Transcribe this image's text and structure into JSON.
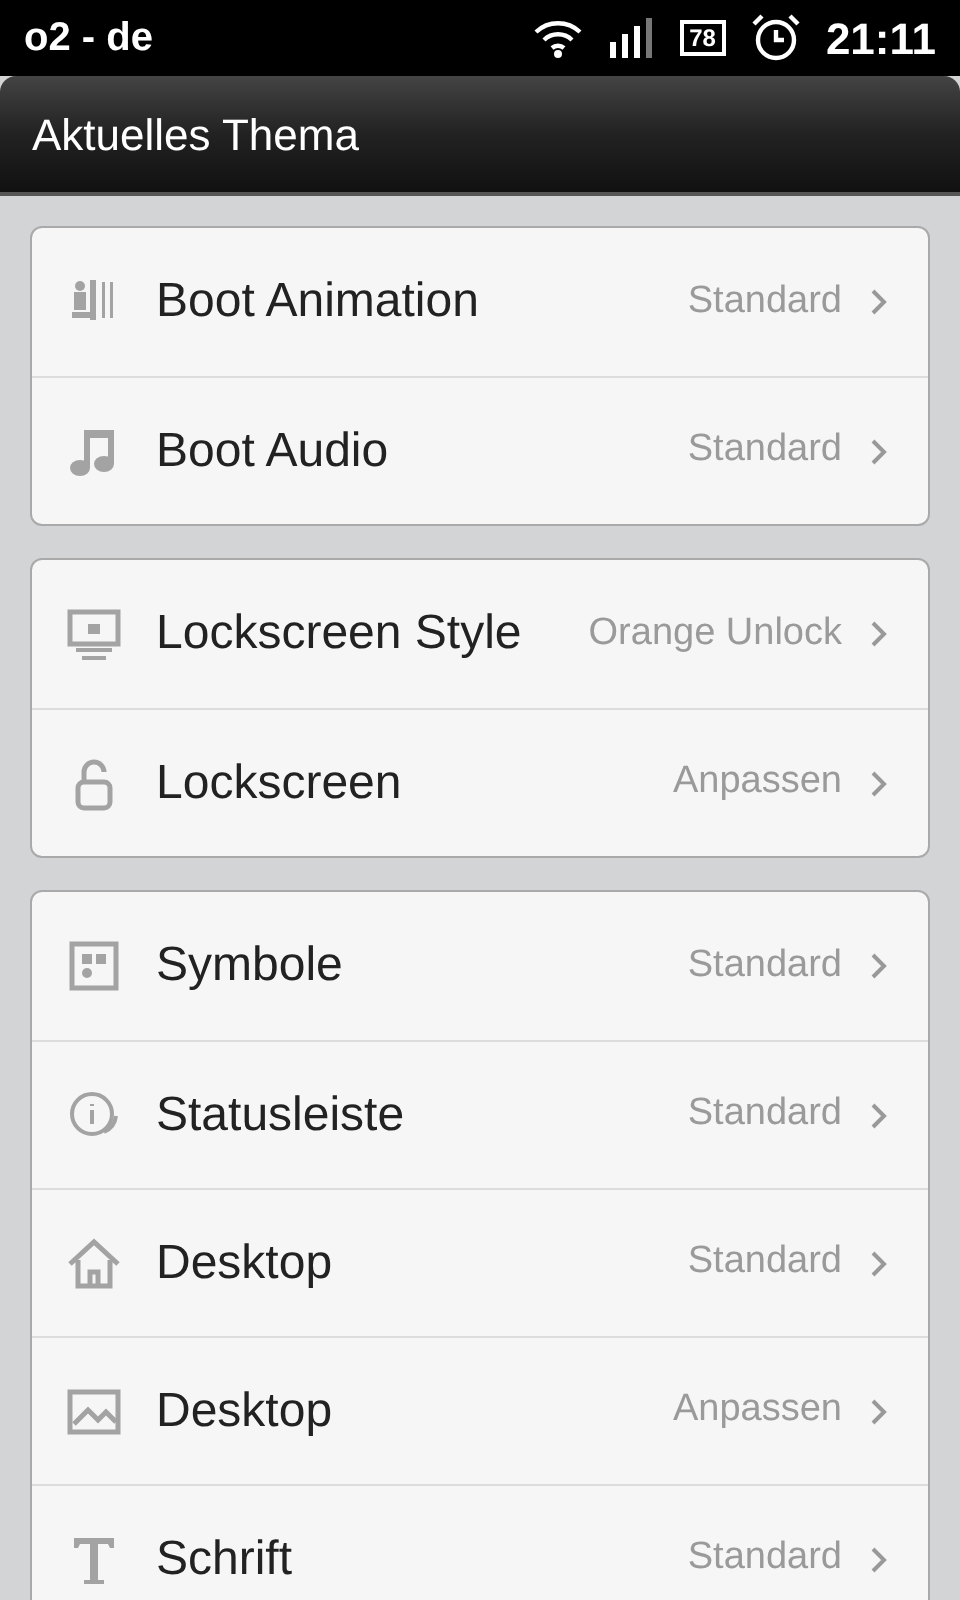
{
  "status_bar": {
    "carrier": "o2 - de",
    "battery": "78",
    "time": "21:11"
  },
  "title": "Aktuelles Thema",
  "groups": [
    {
      "items": [
        {
          "label": "Boot Animation",
          "value": "Standard"
        },
        {
          "label": "Boot Audio",
          "value": "Standard"
        }
      ]
    },
    {
      "items": [
        {
          "label": "Lockscreen Style",
          "value": "Orange Unlock"
        },
        {
          "label": "Lockscreen",
          "value": "Anpassen"
        }
      ]
    },
    {
      "items": [
        {
          "label": "Symbole",
          "value": "Standard"
        },
        {
          "label": "Statusleiste",
          "value": "Standard"
        },
        {
          "label": "Desktop",
          "value": "Standard"
        },
        {
          "label": "Desktop",
          "value": "Anpassen"
        },
        {
          "label": "Schrift",
          "value": "Standard"
        }
      ]
    }
  ]
}
